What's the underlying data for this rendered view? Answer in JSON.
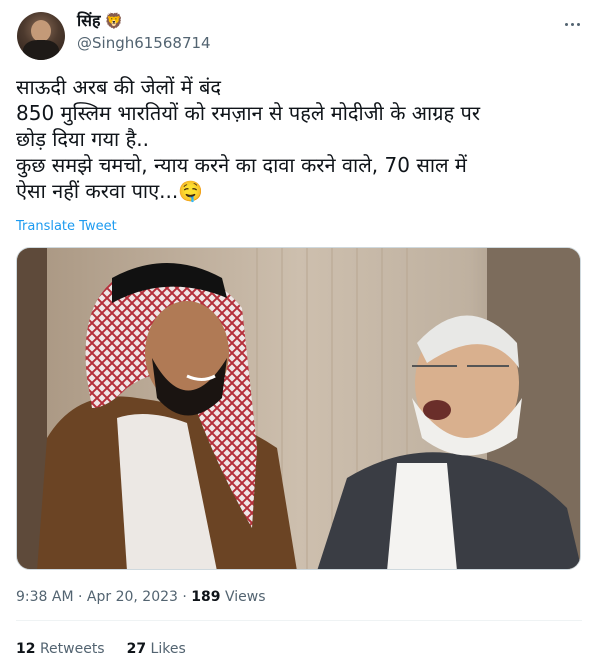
{
  "author": {
    "display_name": "सिंह",
    "name_emoji": "🦁",
    "handle": "@Singh61568714",
    "avatar_icon": "profile-photo"
  },
  "tweet": {
    "lines": [
      "साऊदी अरब की जेलों में बंद",
      "850 मुस्लिम भारतियों को रमज़ान से पहले मोदीजी के आग्रह पर",
      "छोड़ दिया गया है..",
      "कुछ समझे चमचो, न्याय करने का दावा करने वाले, 70 साल में",
      "ऐसा नहीं करवा पाए..."
    ],
    "end_emoji": "🤤",
    "translate_label": "Translate Tweet",
    "media_icon": "photo-two-men-laughing"
  },
  "meta": {
    "time": "9:38 AM",
    "date": "Apr 20, 2023",
    "views_count": "189",
    "views_label": "Views"
  },
  "stats": {
    "retweets_count": "12",
    "retweets_label": "Retweets",
    "likes_count": "27",
    "likes_label": "Likes"
  },
  "colors": {
    "link": "#1d9bf0",
    "secondary_text": "#536471",
    "primary_text": "#0f1419"
  }
}
